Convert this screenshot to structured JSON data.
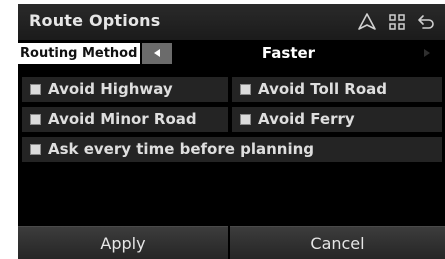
{
  "header": {
    "title": "Route Options",
    "icons": [
      "navigation-arrow-icon",
      "grid-menu-icon",
      "back-icon"
    ]
  },
  "routing": {
    "label": "Routing Method",
    "value": "Faster",
    "prev_icon": "left-arrow-icon",
    "next_icon": "right-arrow-icon"
  },
  "options": {
    "avoid_highway": "Avoid Highway",
    "avoid_toll_road": "Avoid Toll Road",
    "avoid_minor_road": "Avoid Minor Road",
    "avoid_ferry": "Avoid Ferry",
    "ask_every_time": "Ask every time before planning"
  },
  "buttons": {
    "apply": "Apply",
    "cancel": "Cancel"
  },
  "colors": {
    "background": "#000000",
    "option_bg": "#242424",
    "label_bg": "#ffffff",
    "text": "#e6e6e6"
  }
}
